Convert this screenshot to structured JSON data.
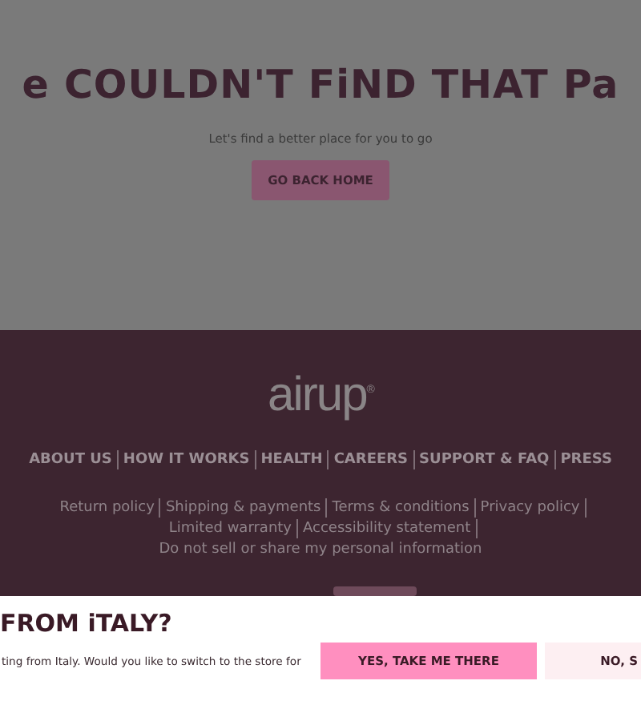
{
  "error_page": {
    "heading": "e COULDN'T FiND THAT Pa",
    "subtitle": "Let's find a better place for you to go",
    "button": "GO BACK HOME"
  },
  "footer": {
    "logo": "airup",
    "logo_mark": "®",
    "nav_links": [
      "ABOUT US",
      "HOW IT WORKS",
      "HEALTH",
      "CAREERS",
      "SUPPORT & FAQ",
      "PRESS"
    ],
    "legal_links": [
      "Return policy",
      "Shipping & payments",
      "Terms & conditions",
      "Privacy policy",
      "Limited warranty",
      "Accessibility statement",
      "Do not sell or share my personal information"
    ]
  },
  "store_banner": {
    "title": "FROM iTALY?",
    "message": "ting from Italy. Would you like to switch to the store for",
    "buttons": [
      {
        "label": "YES, TAKE ME THERE",
        "kind": "primary"
      },
      {
        "label": "NO, S",
        "kind": "secondary"
      }
    ]
  }
}
